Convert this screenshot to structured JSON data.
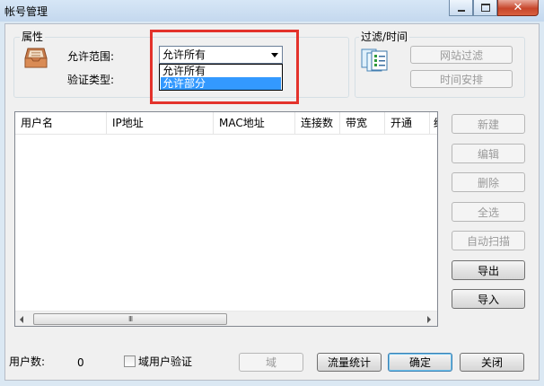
{
  "window": {
    "title": "帐号管理",
    "controls": [
      "minimize",
      "maximize",
      "close"
    ]
  },
  "properties": {
    "group_label": "属性",
    "allow_range_label": "允许范围:",
    "allow_range_value": "允许所有",
    "allow_range_options": [
      "允许所有",
      "允许部分"
    ],
    "allow_range_highlighted_option": "允许部分",
    "verify_type_label": "验证类型:"
  },
  "filter_time": {
    "group_label": "过滤/时间",
    "website_filter_button": "网站过滤",
    "schedule_button": "时间安排"
  },
  "user_list": {
    "columns": [
      "用户名",
      "IP地址",
      "MAC地址",
      "连接数",
      "带宽",
      "开通",
      "结"
    ],
    "rows": [],
    "scroll_grip": "III"
  },
  "side_buttons": {
    "new": "新建",
    "edit": "编辑",
    "delete": "删除",
    "select_all": "全选",
    "auto_scan": "自动扫描",
    "export": "导出",
    "import": "导入"
  },
  "footer": {
    "user_count_label": "用户数:",
    "user_count_value": "0",
    "domain_verify_label": "域用户验证",
    "domain_verify_checked": false,
    "domain_button": "域",
    "traffic_stats_button": "流量统计",
    "ok_button": "确定",
    "close_button": "关闭"
  },
  "colors": {
    "highlight_border": "#e3322b",
    "selection": "#3399ff"
  }
}
